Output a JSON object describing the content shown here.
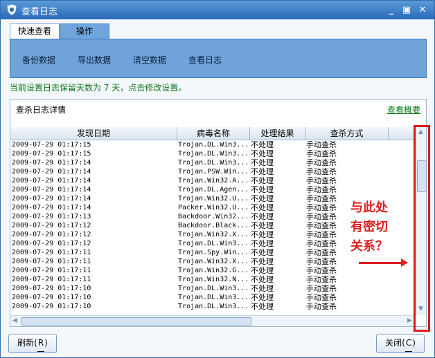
{
  "window": {
    "title": "查看日志"
  },
  "tabs": [
    {
      "label": "快速查看"
    },
    {
      "label": "操作"
    }
  ],
  "actions": [
    {
      "label": "备份数据"
    },
    {
      "label": "导出数据"
    },
    {
      "label": "清空数据"
    },
    {
      "label": "查看日志"
    }
  ],
  "notice": "当前设置日志保留天数为 7 天，点击修改设置。",
  "detail": {
    "title": "查杀日志详情",
    "overview_link": "查看概要"
  },
  "table": {
    "columns": [
      "发现日期",
      "病毒名称",
      "处理结果",
      "查杀方式"
    ],
    "rows": [
      {
        "date": "2009-07-29 01:17:15",
        "name": "Trojan.DL.Win3...",
        "result": "不处理",
        "method": "手动查杀"
      },
      {
        "date": "2009-07-29 01:17:15",
        "name": "Trojan.DL.Win3...",
        "result": "不处理",
        "method": "手动查杀"
      },
      {
        "date": "2009-07-29 01:17:14",
        "name": "Trojan.DL.Win3...",
        "result": "不处理",
        "method": "手动查杀"
      },
      {
        "date": "2009-07-29 01:17:14",
        "name": "Trojan.PSW.Win...",
        "result": "不处理",
        "method": "手动查杀"
      },
      {
        "date": "2009-07-29 01:17:14",
        "name": "Trojan.Win32.A...",
        "result": "不处理",
        "method": "手动查杀"
      },
      {
        "date": "2009-07-29 01:17:14",
        "name": "Trojan.DL.Agen...",
        "result": "不处理",
        "method": "手动查杀"
      },
      {
        "date": "2009-07-29 01:17:14",
        "name": "Trojan.Win32.U...",
        "result": "不处理",
        "method": "手动查杀"
      },
      {
        "date": "2009-07-29 01:17:14",
        "name": "Packer.Win32.U...",
        "result": "不处理",
        "method": "手动查杀"
      },
      {
        "date": "2009-07-29 01:17:13",
        "name": "Backdoor.Win32...",
        "result": "不处理",
        "method": "手动查杀"
      },
      {
        "date": "2009-07-29 01:17:12",
        "name": "Backdoor.Black...",
        "result": "不处理",
        "method": "手动查杀"
      },
      {
        "date": "2009-07-29 01:17:12",
        "name": "Trojan.Win32.X...",
        "result": "不处理",
        "method": "手动查杀"
      },
      {
        "date": "2009-07-29 01:17:12",
        "name": "Trojan.DL.Win3...",
        "result": "不处理",
        "method": "手动查杀"
      },
      {
        "date": "2009-07-29 01:17:11",
        "name": "Trojan.Spy.Win...",
        "result": "不处理",
        "method": "手动查杀"
      },
      {
        "date": "2009-07-29 01:17:11",
        "name": "Trojan.Win32.X...",
        "result": "不处理",
        "method": "手动查杀"
      },
      {
        "date": "2009-07-29 01:17:11",
        "name": "Trojan.Win32.G...",
        "result": "不处理",
        "method": "手动查杀"
      },
      {
        "date": "2009-07-29 01:17:11",
        "name": "Trojan.Win32.N...",
        "result": "不处理",
        "method": "手动查杀"
      },
      {
        "date": "2009-07-29 01:17:10",
        "name": "Trojan.DL.Win3...",
        "result": "不处理",
        "method": "手动查杀"
      },
      {
        "date": "2009-07-29 01:17:10",
        "name": "Trojan.DL.Win3...",
        "result": "不处理",
        "method": "手动查杀"
      },
      {
        "date": "2009-07-29 01:17:10",
        "name": "Trojan.DL.Win3...",
        "result": "不处理",
        "method": "手动查杀"
      }
    ]
  },
  "annotation": {
    "line1": "与此处",
    "line2": "有密切",
    "line3": "关系？"
  },
  "buttons": {
    "refresh": {
      "label": "刷新",
      "key": "R"
    },
    "close": {
      "label": "关闭",
      "key": "C"
    }
  },
  "colors": {
    "title_bar": "#2a6ab8",
    "panel": "#6fa3d9",
    "notice": "#0c7a1a",
    "annotation": "#e02020"
  },
  "icons": {
    "app": "shield-icon",
    "minimize": "minimize-icon",
    "maximize": "maximize-icon",
    "close": "close-icon"
  }
}
